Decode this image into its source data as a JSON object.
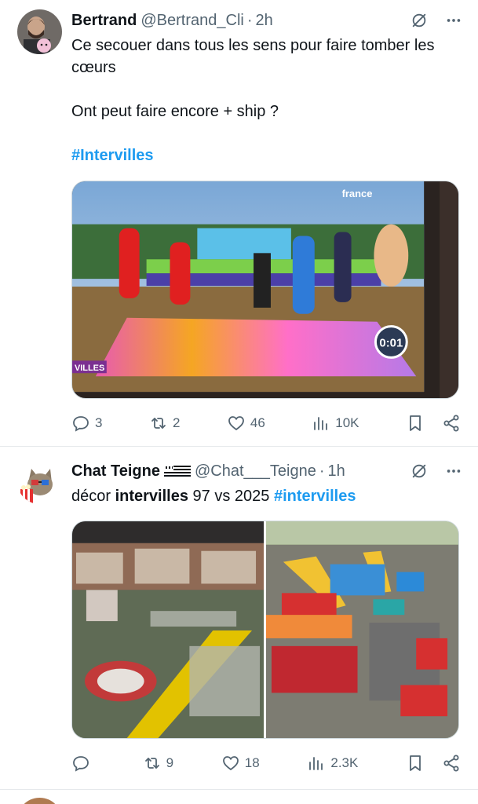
{
  "tweets": [
    {
      "author_name": "Bertrand",
      "handle": "@Bertrand_Cli",
      "separator": "·",
      "time": "2h",
      "text_lines": [
        "Ce secouer dans tous les sens pour faire tomber les cœurs",
        "Ont peut faire encore + ship ?"
      ],
      "hashtag": "#Intervilles",
      "video_overlay": {
        "channel": "france",
        "timer": "0:01",
        "corner_label": "VILLES"
      },
      "stats": {
        "replies": "3",
        "reposts": "2",
        "likes": "46",
        "views": "10K"
      }
    },
    {
      "author_name": "Chat Teigne",
      "handle": "@Chat___Teigne",
      "separator": "·",
      "time": "1h",
      "text_parts": {
        "p1": "décor ",
        "p2": "intervilles",
        "p3": " 97 vs 2025 ",
        "p4": "#intervilles"
      },
      "stats": {
        "replies": "",
        "reposts": "9",
        "likes": "18",
        "views": "2.3K"
      }
    }
  ],
  "icons": {
    "reply": "speech-bubble-icon",
    "repost": "repost-arrows-icon",
    "like": "heart-outline-icon",
    "views": "bar-chart-icon",
    "bookmark": "bookmark-outline-icon",
    "share": "share-nodes-icon",
    "grok": "grok-slash-icon",
    "more": "three-dots-icon"
  },
  "colors": {
    "accent": "#1d9bf0",
    "secondary_text": "#536471",
    "divider": "#e6e9ec"
  }
}
